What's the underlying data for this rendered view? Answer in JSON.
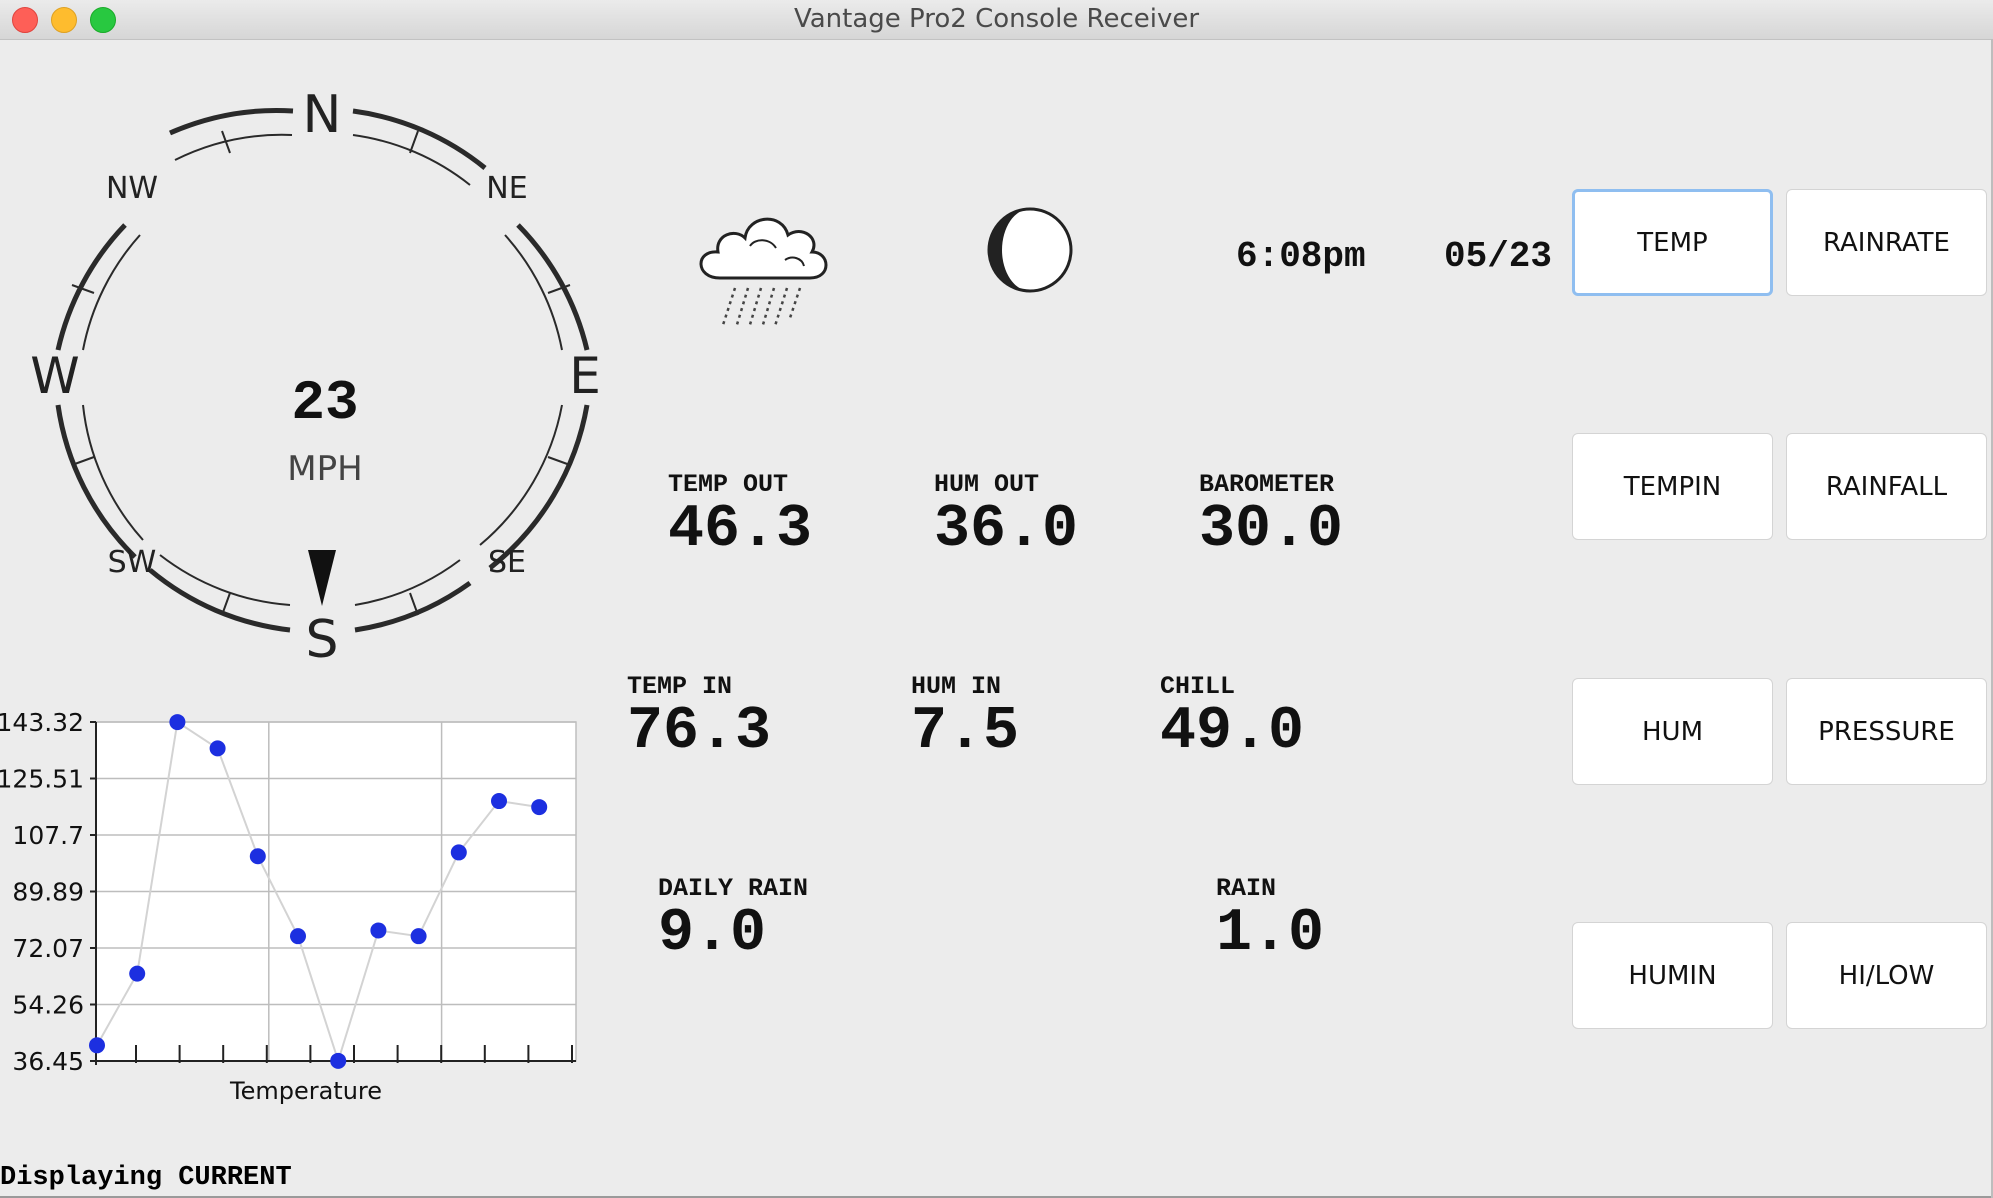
{
  "window": {
    "title": "Vantage Pro2 Console Receiver",
    "traffic_lights": {
      "close": "#fe5f57",
      "minimize": "#febc2e",
      "zoom": "#28c840"
    }
  },
  "wind": {
    "speed": "23",
    "unit": "MPH",
    "compass_labels": {
      "n": "N",
      "ne": "NE",
      "e": "E",
      "se": "SE",
      "s": "S",
      "sw": "SW",
      "w": "W",
      "nw": "NW"
    },
    "direction_label": "S"
  },
  "conditions": {
    "forecast_icon": "rain-cloud-icon",
    "moon_icon": "moon-phase-icon",
    "time": "6:08pm",
    "date": "05/23"
  },
  "readings": {
    "temp_out": {
      "label": "TEMP OUT",
      "value": "46.3"
    },
    "hum_out": {
      "label": "HUM OUT",
      "value": "36.0"
    },
    "barometer": {
      "label": "BAROMETER",
      "value": "30.0"
    },
    "temp_in": {
      "label": "TEMP IN",
      "value": "76.3"
    },
    "hum_in": {
      "label": "HUM IN",
      "value": "7.5"
    },
    "chill": {
      "label": "CHILL",
      "value": "49.0"
    },
    "daily_rain": {
      "label": "DAILY RAIN",
      "value": "9.0"
    },
    "rain": {
      "label": "RAIN",
      "value": "1.0"
    }
  },
  "buttons": {
    "temp": "TEMP",
    "rainrate": "RAINRATE",
    "tempin": "TEMPIN",
    "rainfall": "RAINFALL",
    "hum": "HUM",
    "pressure": "PRESSURE",
    "humin": "HUMIN",
    "hilow": "HI/LOW",
    "focused": "TEMP",
    "focus_color": "#8fbef0"
  },
  "chart_data": {
    "type": "line",
    "xlabel": "Temperature",
    "ylabel": "",
    "title": "",
    "y_ticks": [
      "143.32",
      "125.51",
      "107.7",
      "89.89",
      "72.07",
      "54.26",
      "36.45"
    ],
    "ylim": [
      36.45,
      143.32
    ],
    "x": [
      1,
      2,
      3,
      4,
      5,
      6,
      7,
      8,
      9,
      10,
      11,
      12
    ],
    "values": [
      41.4,
      64.0,
      143.3,
      135.0,
      101.0,
      75.8,
      36.5,
      77.6,
      75.8,
      102.2,
      118.4,
      116.5
    ],
    "point_color": "#1c2fe0",
    "line_color": "#d3d3d3",
    "grid": true
  },
  "status": {
    "text": "Displaying CURRENT"
  }
}
